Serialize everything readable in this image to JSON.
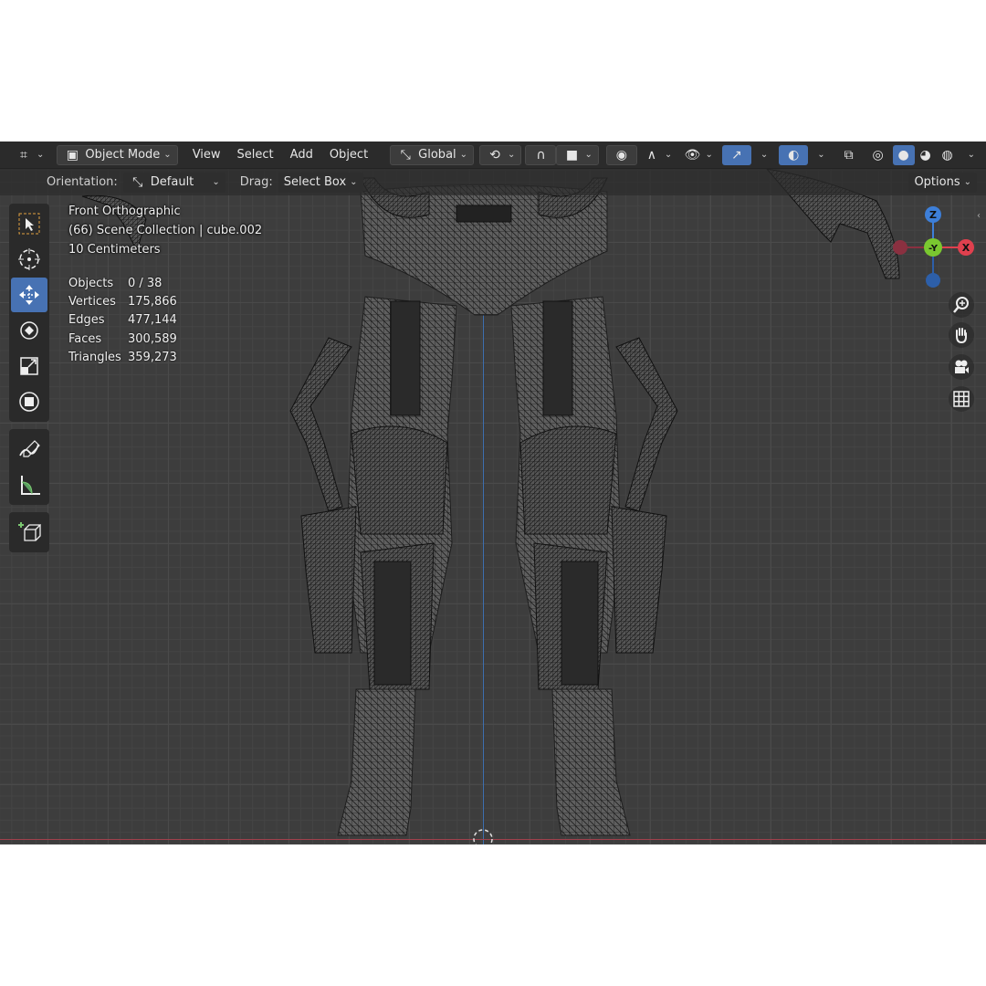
{
  "header": {
    "mode_label": "Object Mode",
    "menus": [
      "View",
      "Select",
      "Add",
      "Object"
    ],
    "transform_orientation": "Global"
  },
  "tool_header": {
    "orientation_label": "Orientation:",
    "orientation_value": "Default",
    "drag_label": "Drag:",
    "drag_value": "Select Box",
    "options_label": "Options"
  },
  "viewport": {
    "view_name": "Front Orthographic",
    "collection": "(66) Scene Collection | cube.002",
    "scale": "10 Centimeters"
  },
  "stats": [
    {
      "label": "Objects",
      "value": "0 / 38"
    },
    {
      "label": "Vertices",
      "value": "175,866"
    },
    {
      "label": "Edges",
      "value": "477,144"
    },
    {
      "label": "Faces",
      "value": "300,589"
    },
    {
      "label": "Triangles",
      "value": "359,273"
    }
  ],
  "gizmo": {
    "z": "Z",
    "y": "-Y",
    "x": "X"
  },
  "colors": {
    "accent": "#4772b3",
    "x_axis": "#e0404e",
    "y_axis": "#7ac730",
    "z_axis": "#3d7fd9"
  }
}
